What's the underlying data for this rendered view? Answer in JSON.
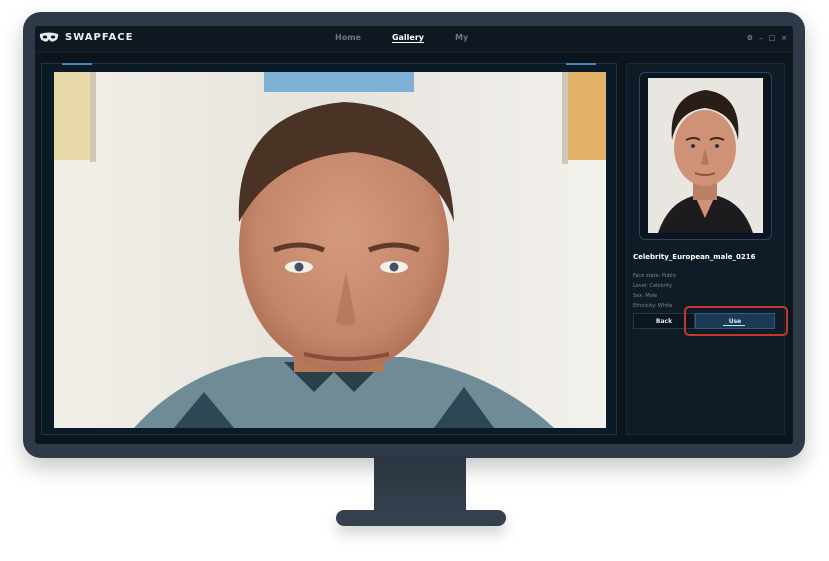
{
  "app": {
    "name": "SWAPFACE",
    "logo_icon": "mask-icon"
  },
  "nav": {
    "items": [
      {
        "label": "Home",
        "active": false
      },
      {
        "label": "Gallery",
        "active": true
      },
      {
        "label": "My",
        "active": false
      }
    ]
  },
  "window_controls": {
    "settings": "⚙",
    "minimize": "–",
    "maximize": "□",
    "close": "×"
  },
  "persona": {
    "name": "Celebrity_European_male_0216",
    "details": [
      "Face state: Public",
      "Level: Celebrity",
      "Sex: Male",
      "Ethnicity: White"
    ]
  },
  "buttons": {
    "back": "Back",
    "use": "Use"
  },
  "colors": {
    "accent": "#2f5f86",
    "highlight": "#c0392b",
    "screen_bg": "#0c141d"
  }
}
